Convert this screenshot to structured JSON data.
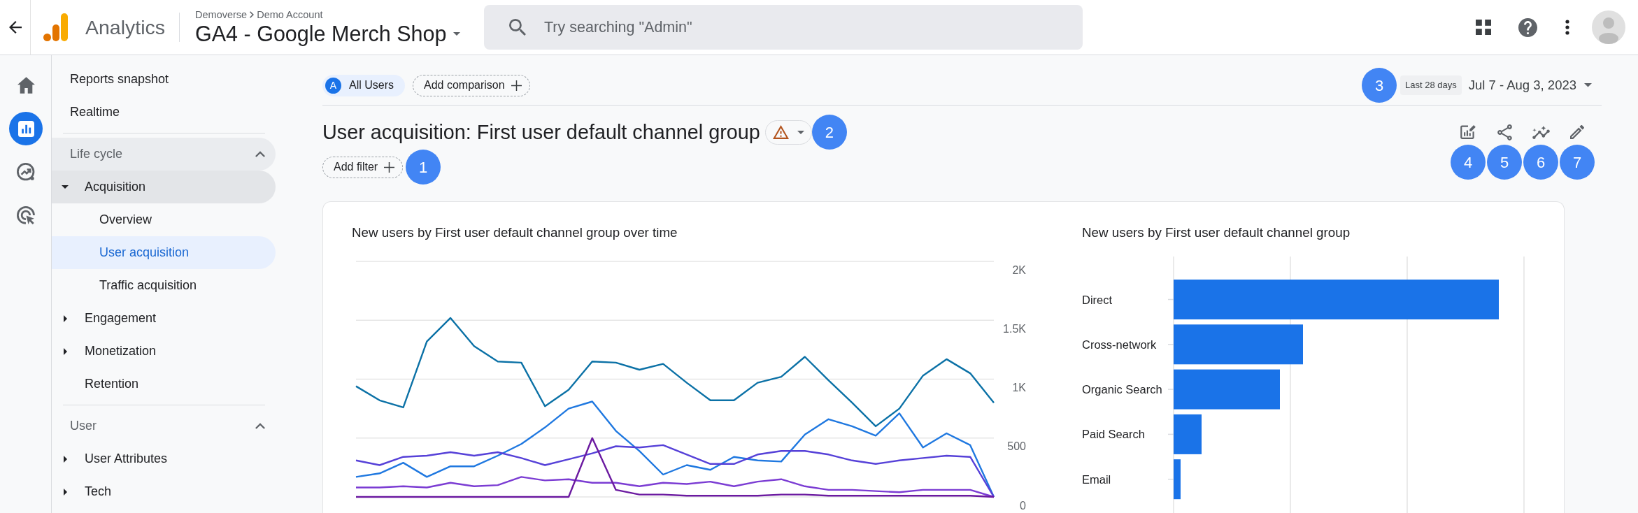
{
  "top_bar": {
    "product": "Analytics",
    "breadcrumb": [
      "Demoverse",
      "Demo Account"
    ],
    "property": "GA4 - Google Merch Shop",
    "search": {
      "placeholder": "Try searching \"Admin\""
    }
  },
  "rail": [
    {
      "selected": false
    },
    {
      "selected": true
    },
    {
      "selected": false
    },
    {
      "selected": false
    }
  ],
  "nav": {
    "items": [
      {
        "label": "Reports snapshot",
        "selected": false
      },
      {
        "label": "Realtime",
        "selected": false
      }
    ],
    "sections": [
      {
        "title": "Life cycle",
        "expanded": true,
        "highlighted": true,
        "items": [
          {
            "label": "Acquisition",
            "expanded": true,
            "highlighted": true,
            "children": [
              {
                "label": "Overview",
                "selected": false
              },
              {
                "label": "User acquisition",
                "selected": true
              },
              {
                "label": "Traffic acquisition",
                "selected": false
              }
            ]
          },
          {
            "label": "Engagement",
            "expanded": false,
            "highlighted": false
          },
          {
            "label": "Monetization",
            "expanded": false,
            "highlighted": false
          },
          {
            "label": "Retention",
            "highlighted": false
          }
        ]
      },
      {
        "title": "User",
        "expanded": true,
        "highlighted": false,
        "items": [
          {
            "label": "User Attributes",
            "expanded": false,
            "highlighted": false
          },
          {
            "label": "Tech",
            "expanded": false,
            "highlighted": false
          }
        ]
      }
    ]
  },
  "comparisons": {
    "segments": [
      {
        "badge": "A",
        "label": "All Users"
      }
    ],
    "add_label": "Add comparison"
  },
  "date_range": {
    "marker": "3",
    "preset": "Last 28 days",
    "range": "Jul 7 - Aug 3, 2023"
  },
  "report": {
    "title": "User acquisition: First user default channel group",
    "title_marker": "2",
    "add_filter": "Add filter",
    "filter_marker": "1"
  },
  "actions": [
    {
      "marker": "4"
    },
    {
      "marker": "5"
    },
    {
      "marker": "6"
    },
    {
      "marker": "7"
    }
  ],
  "line_card": {
    "chart_data": {
      "type": "line",
      "title": "New users by First user default channel group over time",
      "grid": true,
      "ylim": [
        0,
        2000
      ],
      "yticks": [
        {
          "value": 0,
          "label": "0"
        },
        {
          "value": 500,
          "label": "500"
        },
        {
          "value": 1000,
          "label": "1K"
        },
        {
          "value": 1500,
          "label": "1.5K"
        },
        {
          "value": 2000,
          "label": "2K"
        }
      ],
      "series": [
        {
          "color": "#0b71a6",
          "values": [
            940,
            820,
            760,
            1320,
            1520,
            1280,
            1150,
            1140,
            770,
            910,
            1150,
            1140,
            1080,
            1130,
            970,
            820,
            820,
            970,
            1020,
            1190,
            990,
            800,
            600,
            750,
            1030,
            1170,
            1050,
            800
          ]
        },
        {
          "color": "#1f78e0",
          "values": [
            170,
            200,
            290,
            170,
            260,
            260,
            350,
            450,
            590,
            750,
            810,
            560,
            390,
            190,
            270,
            230,
            340,
            310,
            300,
            530,
            660,
            600,
            520,
            710,
            420,
            540,
            440,
            0
          ]
        },
        {
          "color": "#5641d8",
          "values": [
            310,
            270,
            340,
            350,
            380,
            350,
            380,
            330,
            270,
            320,
            370,
            430,
            420,
            440,
            360,
            280,
            280,
            360,
            390,
            390,
            360,
            310,
            280,
            310,
            330,
            350,
            340,
            0
          ]
        },
        {
          "color": "#7b3cd3",
          "values": [
            80,
            80,
            90,
            80,
            120,
            90,
            100,
            170,
            140,
            150,
            120,
            120,
            90,
            120,
            110,
            130,
            90,
            130,
            150,
            90,
            60,
            60,
            50,
            40,
            60,
            60,
            60,
            0
          ]
        },
        {
          "color": "#6b1aa0",
          "values": [
            0,
            0,
            0,
            0,
            0,
            0,
            0,
            0,
            0,
            0,
            500,
            60,
            20,
            20,
            10,
            10,
            10,
            10,
            20,
            20,
            10,
            10,
            10,
            10,
            10,
            10,
            10,
            0
          ]
        }
      ]
    }
  },
  "bar_card": {
    "title": "New users by First user default channel group",
    "categories": [
      "Direct",
      "Cross-network",
      "Organic Search",
      "Paid Search",
      "Email"
    ]
  }
}
